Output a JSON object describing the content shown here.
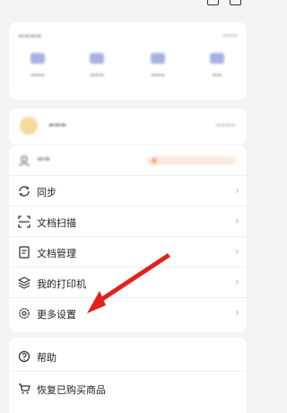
{
  "menu": {
    "items": [
      {
        "label": "同步"
      },
      {
        "label": "文档扫描"
      },
      {
        "label": "文档管理"
      },
      {
        "label": "我的打印机"
      },
      {
        "label": "更多设置"
      }
    ]
  },
  "help": {
    "items": [
      {
        "label": "帮助"
      },
      {
        "label": "恢复已购买商品"
      }
    ]
  },
  "colors": {
    "arrow": "#e0231d",
    "accent": "#8a98d8"
  }
}
